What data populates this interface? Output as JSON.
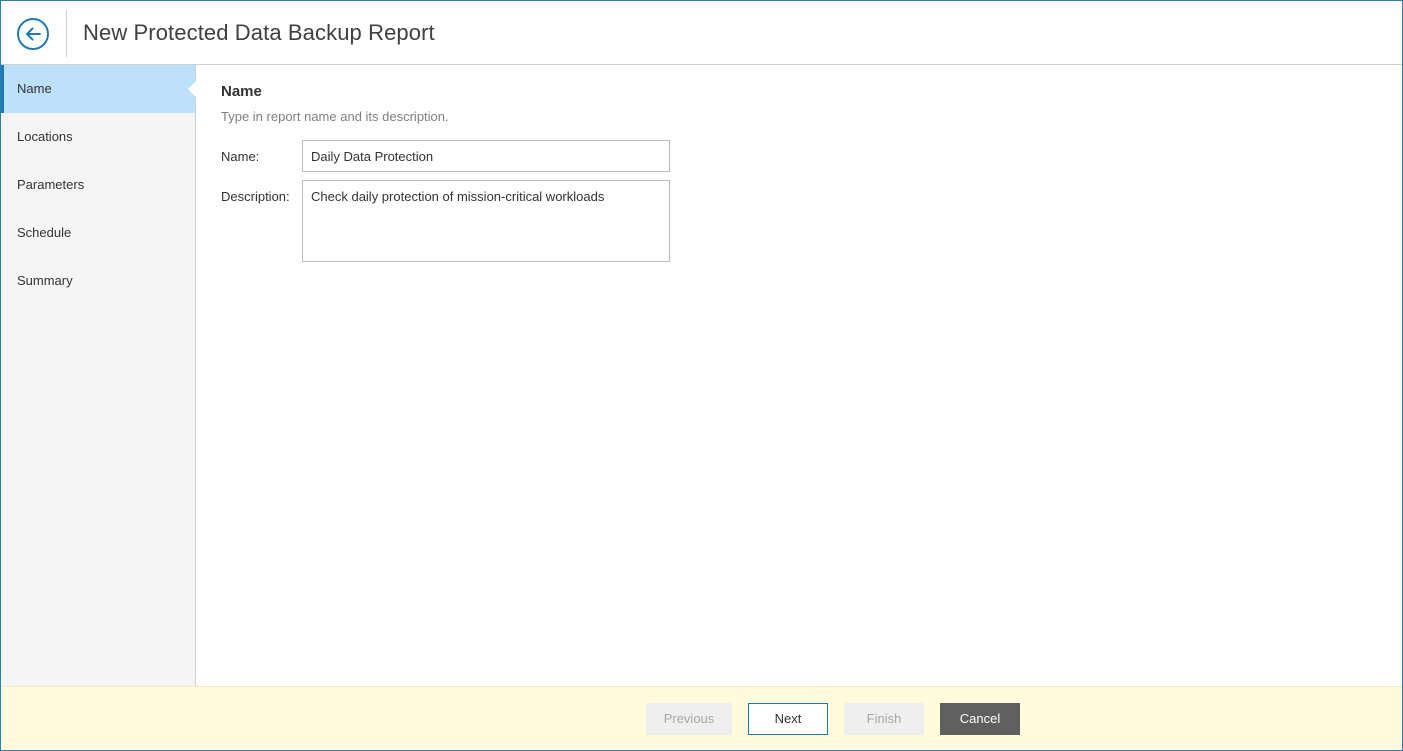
{
  "window": {
    "title": "New Protected Data Backup Report"
  },
  "header": {
    "back_icon": "arrow-left-circle-icon"
  },
  "sidebar": {
    "items": [
      {
        "label": "Name",
        "active": true
      },
      {
        "label": "Locations",
        "active": false
      },
      {
        "label": "Parameters",
        "active": false
      },
      {
        "label": "Schedule",
        "active": false
      },
      {
        "label": "Summary",
        "active": false
      }
    ]
  },
  "main": {
    "section_title": "Name",
    "section_subtitle": "Type in report name and its description.",
    "name_label": "Name:",
    "name_value": "Daily Data Protection",
    "description_label": "Description:",
    "description_value": "Check daily protection of mission-critical workloads"
  },
  "footer": {
    "previous_label": "Previous",
    "next_label": "Next",
    "finish_label": "Finish",
    "cancel_label": "Cancel"
  },
  "colors": {
    "accent": "#1d7ab8",
    "active_step_bg": "#bde0fb",
    "footer_bg": "#fffbdc",
    "cancel_bg": "#5f5f5f"
  }
}
